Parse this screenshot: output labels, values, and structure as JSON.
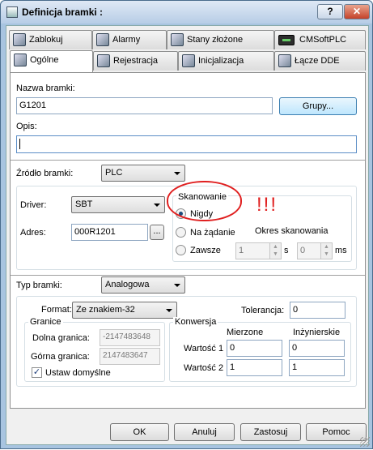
{
  "window": {
    "title": "Definicja bramki :",
    "help": "?",
    "close": "✕"
  },
  "tabs_top": [
    "Zablokuj",
    "Alarmy",
    "Stany złożone",
    "CMSoftPLC"
  ],
  "tabs_bottom": [
    "Ogólne",
    "Rejestracja",
    "Inicjalizacja",
    "Łącze DDE"
  ],
  "general": {
    "nazwa_label": "Nazwa bramki:",
    "nazwa_value": "G1201",
    "grupy_button": "Grupy...",
    "opis_label": "Opis:",
    "opis_value": "",
    "zrodlo_label": "Źródło bramki:",
    "zrodlo_value": "PLC",
    "driver_label": "Driver:",
    "driver_value": "SBT",
    "adres_label": "Adres:",
    "adres_value": "000R1201",
    "adres_button": "...",
    "skan_legend": "Skanowanie",
    "skan_nigdy": "Nigdy",
    "skan_na_zadanie": "Na żądanie",
    "skan_zawsze": "Zawsze",
    "okres_label": "Okres skanowania",
    "okres_s_value": "1",
    "okres_s_unit": "s",
    "okres_ms_value": "0",
    "okres_ms_unit": "ms",
    "annotation": "!!!",
    "typ_label": "Typ bramki:",
    "typ_value": "Analogowa",
    "format_label": "Format:",
    "format_value": "Ze znakiem-32",
    "tolerancja_label": "Tolerancja:",
    "tolerancja_value": "0",
    "granice_legend": "Granice",
    "dolna_label": "Dolna granica:",
    "dolna_value": "-2147483648",
    "gorna_label": "Górna granica:",
    "gorna_value": "2147483647",
    "ustaw_label": "Ustaw domyślne",
    "konwersja_legend": "Konwersja",
    "mierzone_header": "Mierzone",
    "inzynierskie_header": "Inżynierskie",
    "wartosc1_label": "Wartość 1",
    "wartosc1_mierzone": "0",
    "wartosc1_inz": "0",
    "wartosc2_label": "Wartość 2",
    "wartosc2_mierzone": "1",
    "wartosc2_inz": "1"
  },
  "buttons": {
    "ok": "OK",
    "cancel": "Anuluj",
    "apply": "Zastosuj",
    "help": "Pomoc"
  }
}
